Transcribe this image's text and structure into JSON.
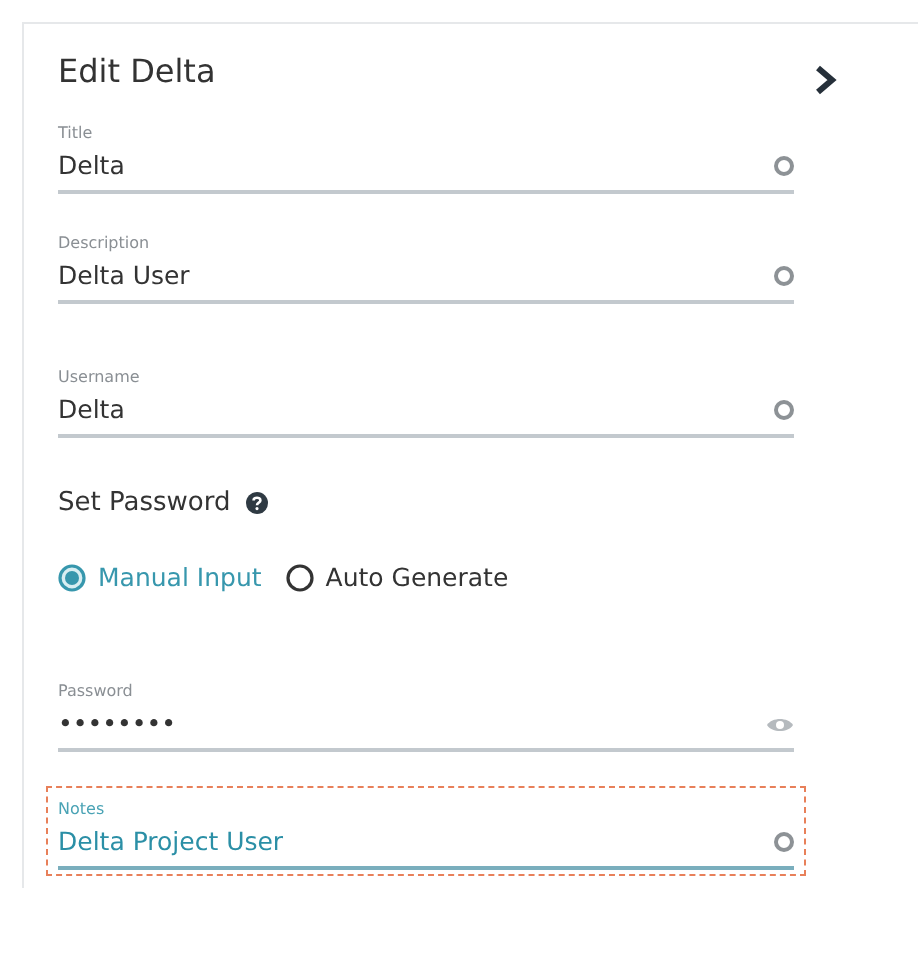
{
  "panel": {
    "title": "Edit Delta"
  },
  "fields": [
    {
      "kind": "text",
      "label": "Title",
      "value": "Delta",
      "focused": false
    },
    {
      "kind": "text",
      "label": "Description",
      "value": "Delta User",
      "focused": false
    },
    {
      "kind": "text",
      "label": "Username",
      "value": "Delta",
      "focused": false
    }
  ],
  "password_section": {
    "heading": "Set Password",
    "options": [
      {
        "label": "Manual Input",
        "selected": true
      },
      {
        "label": "Auto Generate",
        "selected": false
      }
    ]
  },
  "password_fields": [
    {
      "kind": "password",
      "label": "Password",
      "value": "••••••••",
      "focused": false
    },
    {
      "kind": "text",
      "label": "Notes",
      "value": "Delta Project User",
      "focused": true
    }
  ]
}
